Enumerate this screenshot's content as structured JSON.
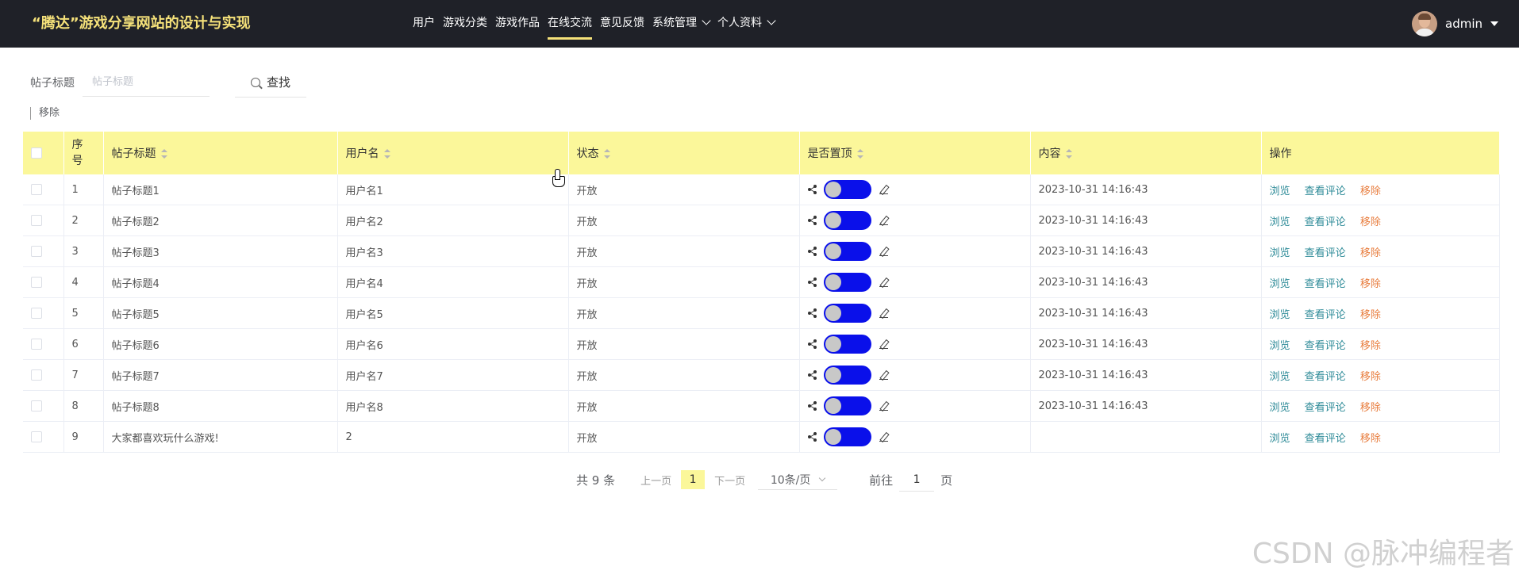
{
  "header": {
    "title": "“腾达”游戏分享网站的设计与实现",
    "nav": [
      {
        "label": "用户"
      },
      {
        "label": "游戏分类"
      },
      {
        "label": "游戏作品"
      },
      {
        "label": "在线交流",
        "active": true
      },
      {
        "label": "意见反馈"
      },
      {
        "label": "系统管理",
        "dropdown": true
      },
      {
        "label": "个人资料",
        "dropdown": true
      }
    ],
    "username": "admin"
  },
  "search": {
    "label": "帖子标题",
    "placeholder": "帖子标题",
    "button": "查找"
  },
  "bulk_remove": "移除",
  "table": {
    "columns": [
      "序号",
      "帖子标题",
      "用户名",
      "状态",
      "是否置顶",
      "内容",
      "操作"
    ],
    "rows": [
      {
        "index": "1",
        "title": "帖子标题1",
        "user": "用户名1",
        "status": "开放",
        "content": "2023-10-31 14:16:43"
      },
      {
        "index": "2",
        "title": "帖子标题2",
        "user": "用户名2",
        "status": "开放",
        "content": "2023-10-31 14:16:43"
      },
      {
        "index": "3",
        "title": "帖子标题3",
        "user": "用户名3",
        "status": "开放",
        "content": "2023-10-31 14:16:43"
      },
      {
        "index": "4",
        "title": "帖子标题4",
        "user": "用户名4",
        "status": "开放",
        "content": "2023-10-31 14:16:43"
      },
      {
        "index": "5",
        "title": "帖子标题5",
        "user": "用户名5",
        "status": "开放",
        "content": "2023-10-31 14:16:43"
      },
      {
        "index": "6",
        "title": "帖子标题6",
        "user": "用户名6",
        "status": "开放",
        "content": "2023-10-31 14:16:43"
      },
      {
        "index": "7",
        "title": "帖子标题7",
        "user": "用户名7",
        "status": "开放",
        "content": "2023-10-31 14:16:43"
      },
      {
        "index": "8",
        "title": "帖子标题8",
        "user": "用户名8",
        "status": "开放",
        "content": "2023-10-31 14:16:43"
      },
      {
        "index": "9",
        "title": "大家都喜欢玩什么游戏!",
        "user": "2",
        "status": "开放",
        "content": ""
      }
    ],
    "actions": {
      "view": "浏览",
      "comments": "查看评论",
      "remove": "移除"
    }
  },
  "pagination": {
    "total": "共 9 条",
    "prev": "上一页",
    "current": "1",
    "next": "下一页",
    "page_size": "10条/页",
    "goto_prefix": "前往",
    "goto_value": "1",
    "goto_suffix": "页"
  },
  "watermark": "CSDN @脉冲编程者",
  "colors": {
    "header_bg": "#1f2128",
    "brand": "#f6e27a",
    "table_header_bg": "#fbf79a",
    "switch_on": "#0a10ea",
    "link": "#2e8b98",
    "danger": "#e87d3e"
  }
}
